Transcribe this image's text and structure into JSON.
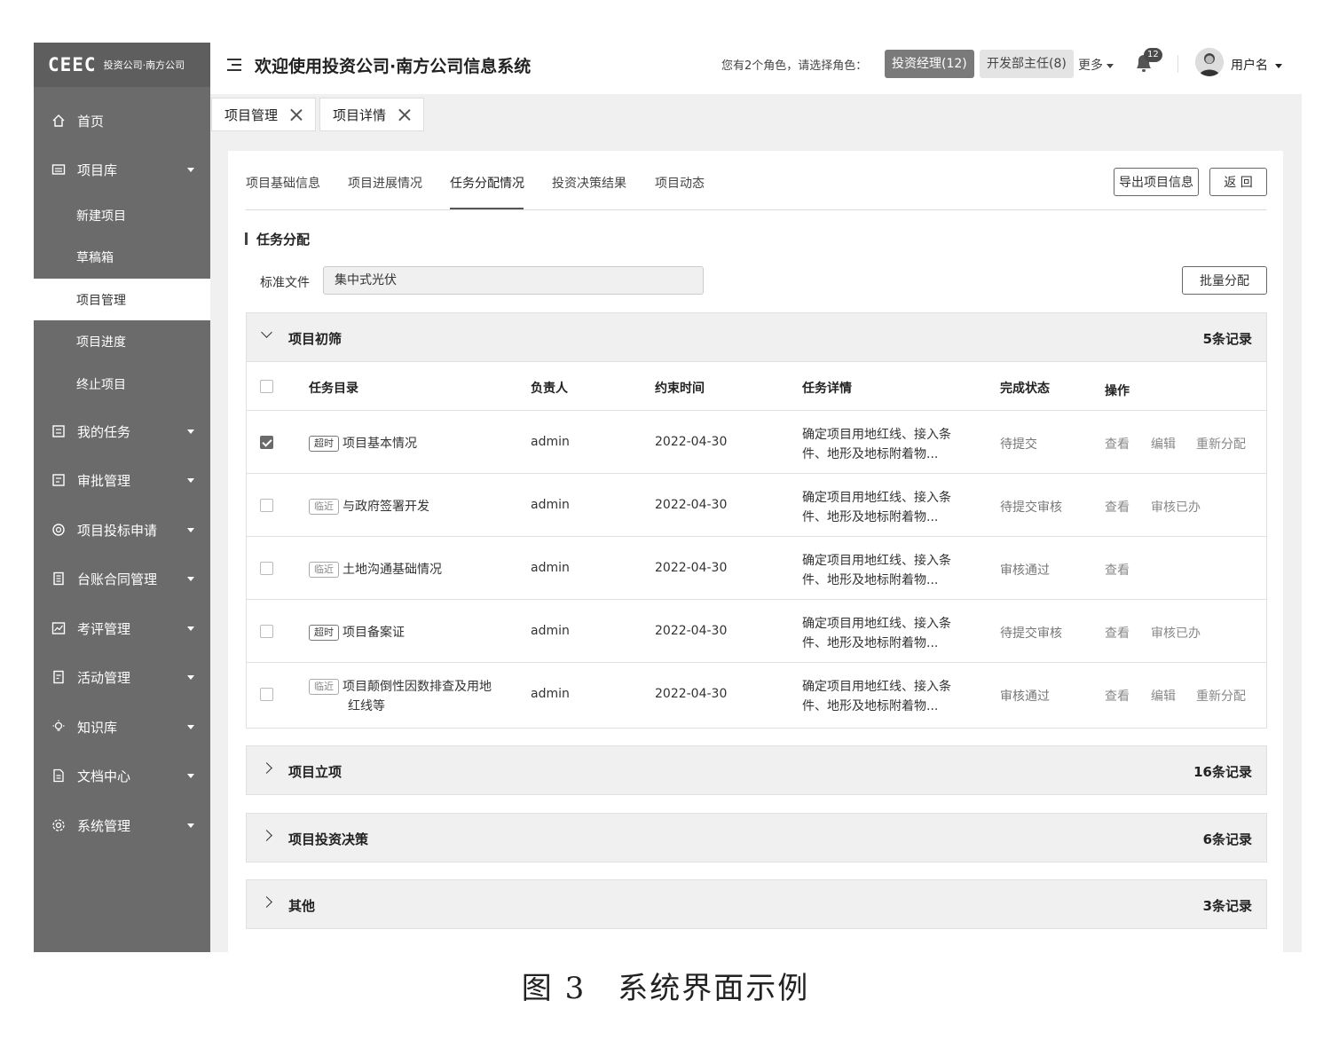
{
  "sidebar": {
    "logo_mark": "CEEC",
    "logo_text": "投资公司·南方公司",
    "items": [
      {
        "label": "首页",
        "icon": "home-icon"
      },
      {
        "label": "项目库",
        "icon": "folder-icon"
      },
      {
        "label": "我的任务",
        "icon": "task-icon"
      },
      {
        "label": "审批管理",
        "icon": "approve-icon"
      },
      {
        "label": "项目投标申请",
        "icon": "target-icon"
      },
      {
        "label": "台账合同管理",
        "icon": "ledger-icon"
      },
      {
        "label": "考评管理",
        "icon": "chart-icon"
      },
      {
        "label": "活动管理",
        "icon": "activity-icon"
      },
      {
        "label": "知识库",
        "icon": "bulb-icon"
      },
      {
        "label": "文档中心",
        "icon": "document-icon"
      },
      {
        "label": "系统管理",
        "icon": "settings-icon"
      }
    ],
    "sub_items": [
      "新建项目",
      "草稿箱",
      "项目管理",
      "项目进度",
      "终止项目"
    ]
  },
  "header": {
    "title": "欢迎使用投资公司·南方公司信息系统",
    "role_prompt": "您有2个角色，请选择角色：",
    "role1": "投资经理(12)",
    "role2": "开发部主任(8)",
    "more": "更多",
    "notif_count": "12",
    "username": "用户名"
  },
  "page_tabs": [
    "项目管理",
    "项目详情"
  ],
  "detail_tabs": [
    "项目基础信息",
    "项目进展情况",
    "任务分配情况",
    "投资决策结果",
    "项目动态"
  ],
  "buttons": {
    "export": "导出项目信息",
    "back": "返 回",
    "batch": "批量分配"
  },
  "section": {
    "title": "任务分配",
    "std_label": "标准文件",
    "std_value": "集中式光伏"
  },
  "groups": [
    {
      "name": "项目初筛",
      "count": "5条记录"
    },
    {
      "name": "项目立项",
      "count": "16条记录"
    },
    {
      "name": "项目投资决策",
      "count": "6条记录"
    },
    {
      "name": "其他",
      "count": "3条记录"
    }
  ],
  "table": {
    "headers": [
      "任务目录",
      "负责人",
      "约束时间",
      "任务详情",
      "完成状态",
      "操作"
    ],
    "rows": [
      {
        "tag": "超时",
        "task": "项目基本情况",
        "task2": "",
        "owner": "admin",
        "date": "2022-04-30",
        "detail1": "确定项目用地红线、接入条",
        "detail2": "件、地形及地标附着物...",
        "status": "待提交",
        "ops": [
          "查看",
          "编辑",
          "重新分配"
        ]
      },
      {
        "tag": "临近",
        "task": "与政府签署开发",
        "task2": "",
        "owner": "admin",
        "date": "2022-04-30",
        "detail1": "确定项目用地红线、接入条",
        "detail2": "件、地形及地标附着物...",
        "status": "待提交审核",
        "ops": [
          "查看",
          "审核已办",
          ""
        ]
      },
      {
        "tag": "临近",
        "task": "土地沟通基础情况",
        "task2": "",
        "owner": "admin",
        "date": "2022-04-30",
        "detail1": "确定项目用地红线、接入条",
        "detail2": "件、地形及地标附着物...",
        "status": "审核通过",
        "ops": [
          "查看",
          "",
          ""
        ]
      },
      {
        "tag": "超时",
        "task": "项目备案证",
        "task2": "",
        "owner": "admin",
        "date": "2022-04-30",
        "detail1": "确定项目用地红线、接入条",
        "detail2": "件、地形及地标附着物...",
        "status": "待提交审核",
        "ops": [
          "查看",
          "审核已办",
          ""
        ]
      },
      {
        "tag": "临近",
        "task": "项目颠倒性因数排查及用地",
        "task2": "红线等",
        "owner": "admin",
        "date": "2022-04-30",
        "detail1": "确定项目用地红线、接入条",
        "detail2": "件、地形及地标附着物...",
        "status": "审核通过",
        "ops": [
          "查看",
          "编辑",
          "重新分配"
        ]
      }
    ]
  },
  "caption": "图 3　系统界面示例"
}
